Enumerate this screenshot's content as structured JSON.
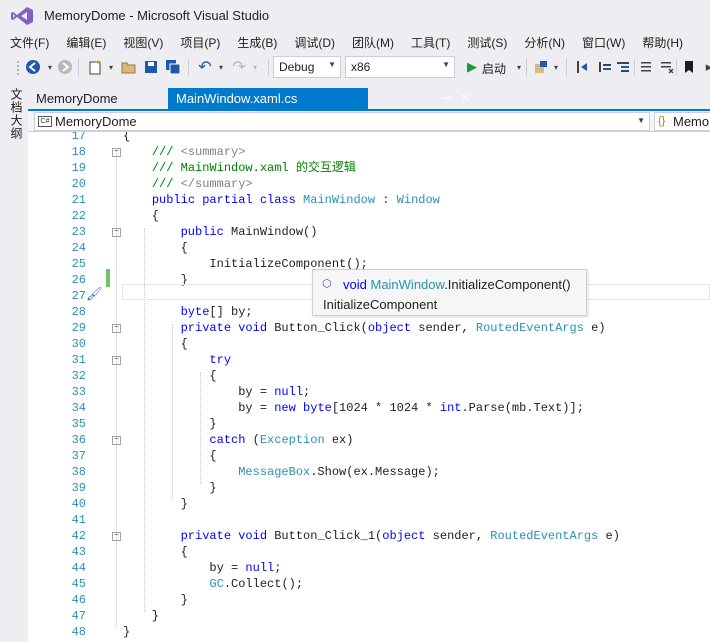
{
  "window": {
    "title": "MemoryDome - Microsoft Visual Studio"
  },
  "menu": [
    "文件(F)",
    "编辑(E)",
    "视图(V)",
    "项目(P)",
    "生成(B)",
    "调试(D)",
    "团队(M)",
    "工具(T)",
    "测试(S)",
    "分析(N)",
    "窗口(W)",
    "帮助(H)"
  ],
  "toolbar": {
    "config": "Debug",
    "platform": "x86",
    "start_label": "启动"
  },
  "side_panel": {
    "tab_label": "文档大纲"
  },
  "tabs": [
    {
      "label": "MemoryDome",
      "active": false
    },
    {
      "label": "MainWindow.xaml.cs",
      "active": true
    }
  ],
  "navbar": {
    "project": "MemoryDome",
    "member": "MemoryDome"
  },
  "tooltip": {
    "kw": "void",
    "type": "MainWindow",
    "member": ".InitializeComponent()",
    "summary": "InitializeComponent"
  },
  "code_lines": [
    {
      "n": "17",
      "fold": "",
      "html": "<span>{</span>"
    },
    {
      "n": "18",
      "fold": "−",
      "html": "    <span class=\"c\">/// </span><span class=\"g\">&lt;summary&gt;</span>"
    },
    {
      "n": "19",
      "fold": "",
      "html": "    <span class=\"c\">/// MainWindow.xaml 的交互逻辑</span>"
    },
    {
      "n": "20",
      "fold": "",
      "html": "    <span class=\"c\">/// </span><span class=\"g\">&lt;/summary&gt;</span>"
    },
    {
      "n": "21",
      "fold": "",
      "html": "    <span class=\"k\">public partial class</span> <span class=\"t\">MainWindow</span> : <span class=\"t\">Window</span>"
    },
    {
      "n": "22",
      "fold": "",
      "html": "    {"
    },
    {
      "n": "23",
      "fold": "−",
      "html": "        <span class=\"k\">public</span> MainWindow()"
    },
    {
      "n": "24",
      "fold": "",
      "html": "        {"
    },
    {
      "n": "25",
      "fold": "",
      "html": "            InitializeComponent();"
    },
    {
      "n": "26",
      "fold": "",
      "html": "        }"
    },
    {
      "n": "27",
      "fold": "",
      "html": ""
    },
    {
      "n": "28",
      "fold": "",
      "html": "        <span class=\"k\">byte</span>[] by;"
    },
    {
      "n": "29",
      "fold": "−",
      "html": "        <span class=\"k\">private void</span> Button_Click(<span class=\"k\">object</span> sender, <span class=\"t\">RoutedEventArgs</span> e)"
    },
    {
      "n": "30",
      "fold": "",
      "html": "        {"
    },
    {
      "n": "31",
      "fold": "−",
      "html": "            <span class=\"k\">try</span>"
    },
    {
      "n": "32",
      "fold": "",
      "html": "            {"
    },
    {
      "n": "33",
      "fold": "",
      "html": "                by = <span class=\"k\">null</span>;"
    },
    {
      "n": "34",
      "fold": "",
      "html": "                by = <span class=\"k\">new byte</span>[1024 * 1024 * <span class=\"k\">int</span>.Parse(mb.Text)];"
    },
    {
      "n": "35",
      "fold": "",
      "html": "            }"
    },
    {
      "n": "36",
      "fold": "−",
      "html": "            <span class=\"k\">catch</span> (<span class=\"t\">Exception</span> ex)"
    },
    {
      "n": "37",
      "fold": "",
      "html": "            {"
    },
    {
      "n": "38",
      "fold": "",
      "html": "                <span class=\"t\">MessageBox</span>.Show(ex.Message);"
    },
    {
      "n": "39",
      "fold": "",
      "html": "            }"
    },
    {
      "n": "40",
      "fold": "",
      "html": "        }"
    },
    {
      "n": "41",
      "fold": "",
      "html": ""
    },
    {
      "n": "42",
      "fold": "−",
      "html": "        <span class=\"k\">private void</span> Button_Click_1(<span class=\"k\">object</span> sender, <span class=\"t\">RoutedEventArgs</span> e)"
    },
    {
      "n": "43",
      "fold": "",
      "html": "        {"
    },
    {
      "n": "44",
      "fold": "",
      "html": "            by = <span class=\"k\">null</span>;"
    },
    {
      "n": "45",
      "fold": "",
      "html": "            <span class=\"t\">GC</span>.Collect();"
    },
    {
      "n": "46",
      "fold": "",
      "html": "        }"
    },
    {
      "n": "47",
      "fold": "",
      "html": "    }"
    },
    {
      "n": "48",
      "fold": "",
      "html": "}"
    }
  ],
  "colors": {
    "accent": "#007acc",
    "keyword": "#0000ff",
    "type": "#2b91af",
    "comment": "#008000",
    "change_bar": "#6bc56b"
  }
}
